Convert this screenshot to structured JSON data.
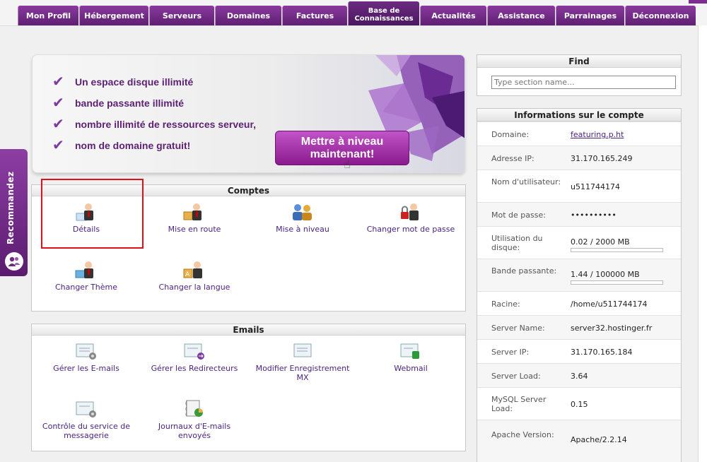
{
  "nav": {
    "tabs": [
      "Mon Profil",
      "Hébergement",
      "Serveurs",
      "Domaines",
      "Factures",
      "Base de Connaissances",
      "Actualités",
      "Assistance",
      "Parrainages",
      "Déconnexion"
    ],
    "active_index": 5
  },
  "sidebar": {
    "recommend_label": "Recommandez"
  },
  "banner": {
    "features": [
      "Un espace disque illimité",
      "bande passante illimité",
      "nombre illimité de ressources serveur,",
      "nom de domaine gratuit!"
    ],
    "cta_label": "Mettre à niveau maintenant!"
  },
  "comptes": {
    "title": "Comptes",
    "items": [
      "Détails",
      "Mise en route",
      "Mise à niveau",
      "Changer mot de passe",
      "Changer Thème",
      "Changer la langue"
    ]
  },
  "emails": {
    "title": "Emails",
    "items": [
      "Gérer les E-mails",
      "Gérer les Redirecteurs",
      "Modifier Enregistrement MX",
      "Webmail",
      "Contrôle du service de messagerie",
      "Journaux d'E-mails envoyés"
    ]
  },
  "find": {
    "title": "Find",
    "placeholder": "Type section name..."
  },
  "account": {
    "title": "Informations sur le compte",
    "rows": [
      {
        "label": "Domaine:",
        "value": "featuring.p.ht"
      },
      {
        "label": "Adresse IP:",
        "value": "31.170.165.249"
      },
      {
        "label": "Nom d'utilisateur:",
        "value": "u511744174"
      },
      {
        "label": "Mot de passe:",
        "value": "••••••••••"
      },
      {
        "label": "Utilisation du disque:",
        "value": "0.02 / 2000 MB"
      },
      {
        "label": "Bande passante:",
        "value": "1.44 / 100000 MB"
      },
      {
        "label": "Racine:",
        "value": "/home/u511744174"
      },
      {
        "label": "Server Name:",
        "value": "server32.hostinger.fr"
      },
      {
        "label": "Server IP:",
        "value": "31.170.165.184"
      },
      {
        "label": "Server Load:",
        "value": "3.64"
      },
      {
        "label": "MySQL Server Load:",
        "value": "0.15"
      },
      {
        "label": "Apache Version:",
        "value": "Apache/2.2.14"
      }
    ],
    "disk_usage_fraction": 1e-05,
    "bandwidth_fraction": 1.44e-05
  },
  "colors": {
    "brand": "#6b2b80",
    "highlight": "#e0101a",
    "link": "#4b2380"
  }
}
